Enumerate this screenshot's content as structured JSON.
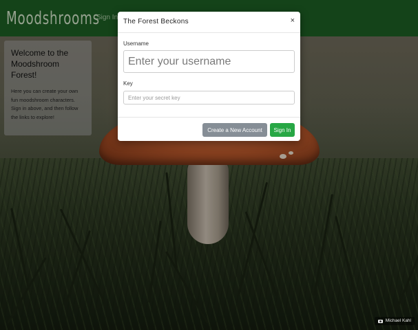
{
  "navbar": {
    "brand": "Moodshrooms",
    "sign_in_link": "Sign In",
    "background_color": "#1c5d23"
  },
  "welcome": {
    "title": "Welcome to the Moodshroom Forest!",
    "body": "Here you can create your own fun moodshroom characters. Sign in above, and then follow the links to explore!"
  },
  "modal": {
    "title": "The Forest Beckons",
    "close_label": "×",
    "username_label": "Username",
    "username_placeholder": "Enter your username",
    "username_value": "",
    "key_label": "Key",
    "key_placeholder": "Enter your secret key",
    "key_value": "",
    "create_account_label": "Create a New Account",
    "sign_in_label": "Sign In",
    "colors": {
      "secondary_button": "#868e96",
      "success_button": "#28a745"
    }
  },
  "credit": {
    "icon": "camera-icon",
    "text": "Michael Kahl"
  }
}
